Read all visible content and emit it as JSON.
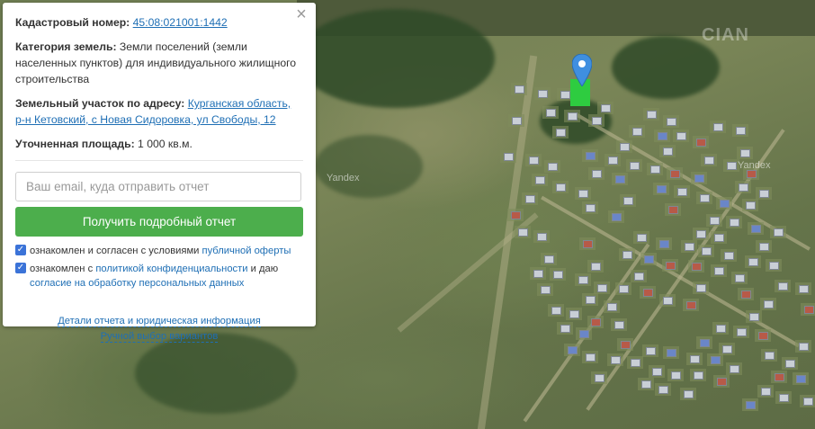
{
  "map": {
    "watermark_1": "Yandex",
    "watermark_2": "Yandex",
    "logo_text": "CIAN"
  },
  "card": {
    "cadastral_label": "Кадастровый номер:",
    "cadastral_value": "45:08:021001:1442",
    "category_label": "Категория земель:",
    "category_value": "Земли поселений (земли населенных пунктов) для индивидуального жилищного строительства",
    "address_label": "Земельный участок по адресу:",
    "address_value": "Курганская область, р-н Кетовский, с Новая Сидоровка, ул Свободы, 12",
    "area_label": "Уточненная площадь:",
    "area_value": "1 000 кв.м.",
    "email_placeholder": "Ваш email, куда отправить отчет",
    "submit_label": "Получить подробный отчет",
    "agree1_text": "ознакомлен и согласен с условиями",
    "agree1_link": "публичной оферты",
    "agree2_text_a": "ознакомлен с",
    "agree2_link": "политикой конфиденциальности",
    "agree2_text_b": "и даю",
    "agree2_link2": "согласие на обработку персональных данных",
    "details_link": "Детали отчета и юридическая информация",
    "manual_link": "Ручной выбор вариантов",
    "close_glyph": "×",
    "check_glyph": "✓"
  }
}
